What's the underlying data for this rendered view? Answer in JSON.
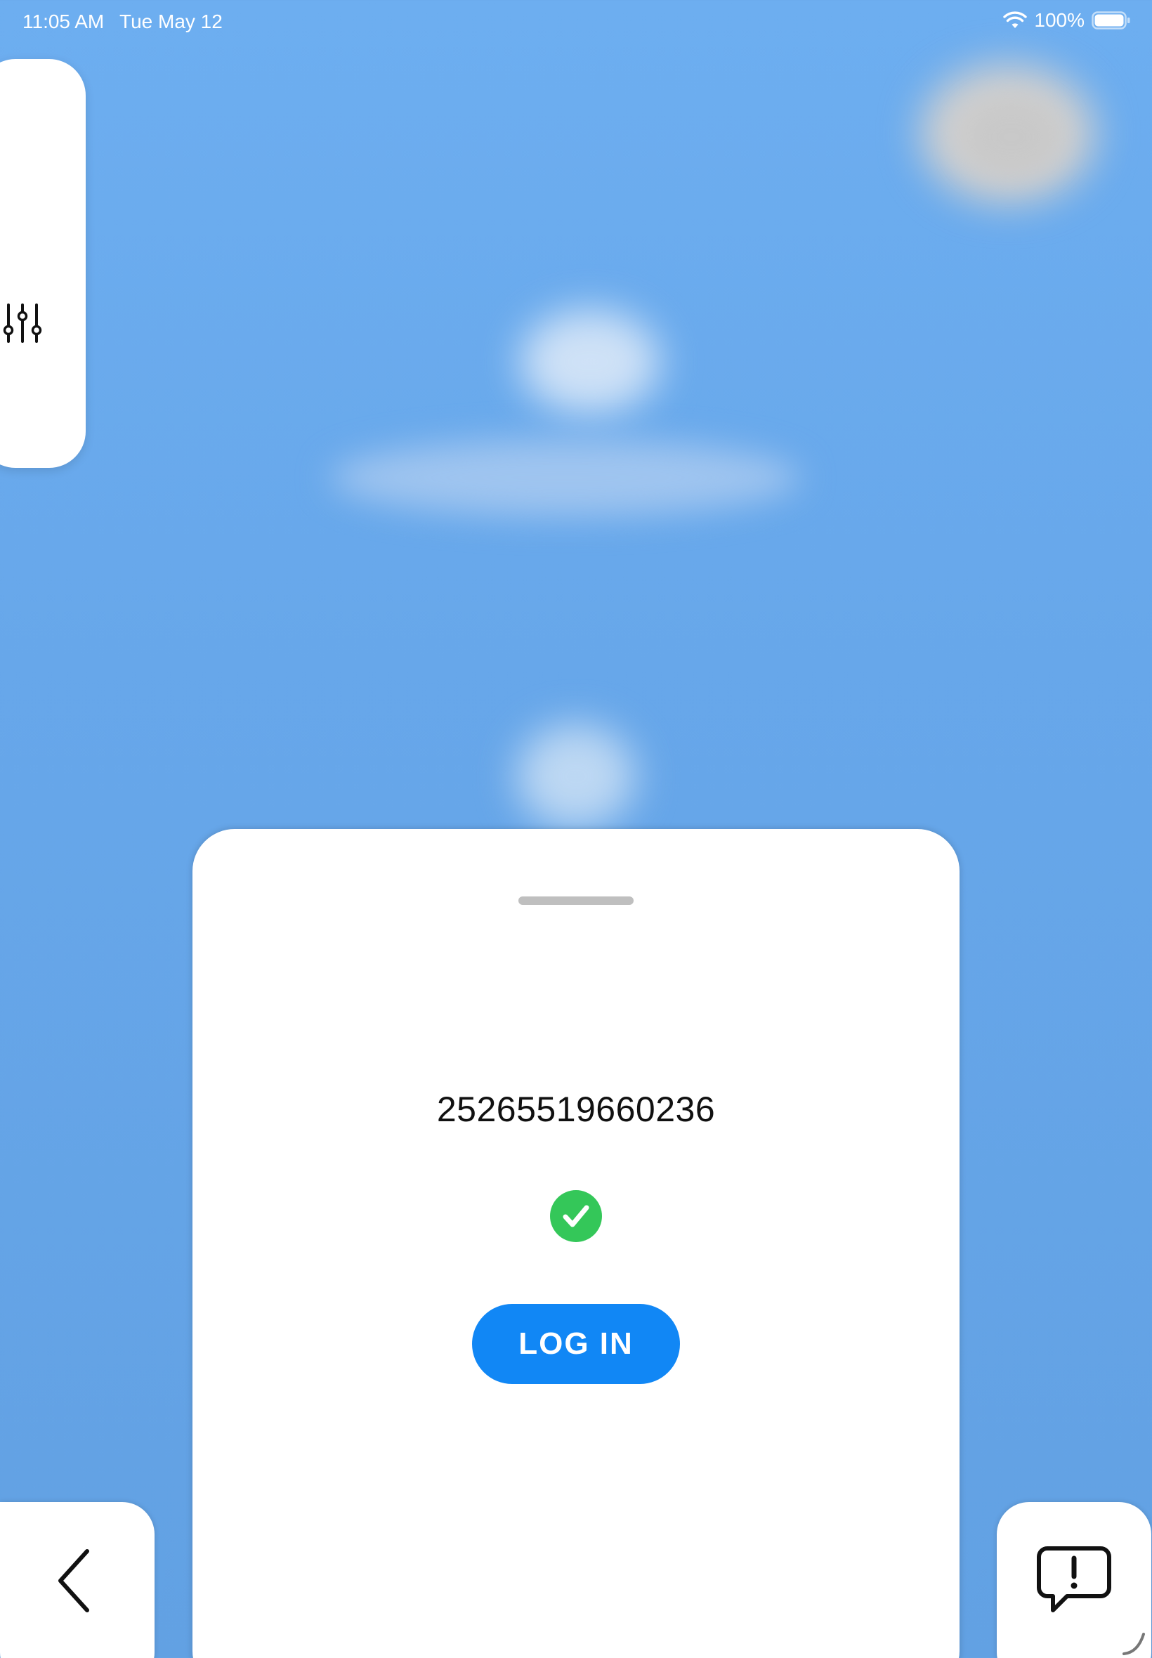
{
  "status_bar": {
    "time": "11:05 AM",
    "date": "Tue May 12",
    "battery": "100%"
  },
  "side_panel": {
    "icon": "sliders-icon"
  },
  "card": {
    "number": "25265519660236",
    "status_icon": "checkmark-circle-icon",
    "login_label": "LOG IN"
  },
  "bottom_bar": {
    "back_icon": "chevron-left-icon",
    "feedback_icon": "chat-alert-icon"
  },
  "colors": {
    "accent": "#1187f5",
    "success": "#34c759",
    "background": "#67a7ea"
  }
}
